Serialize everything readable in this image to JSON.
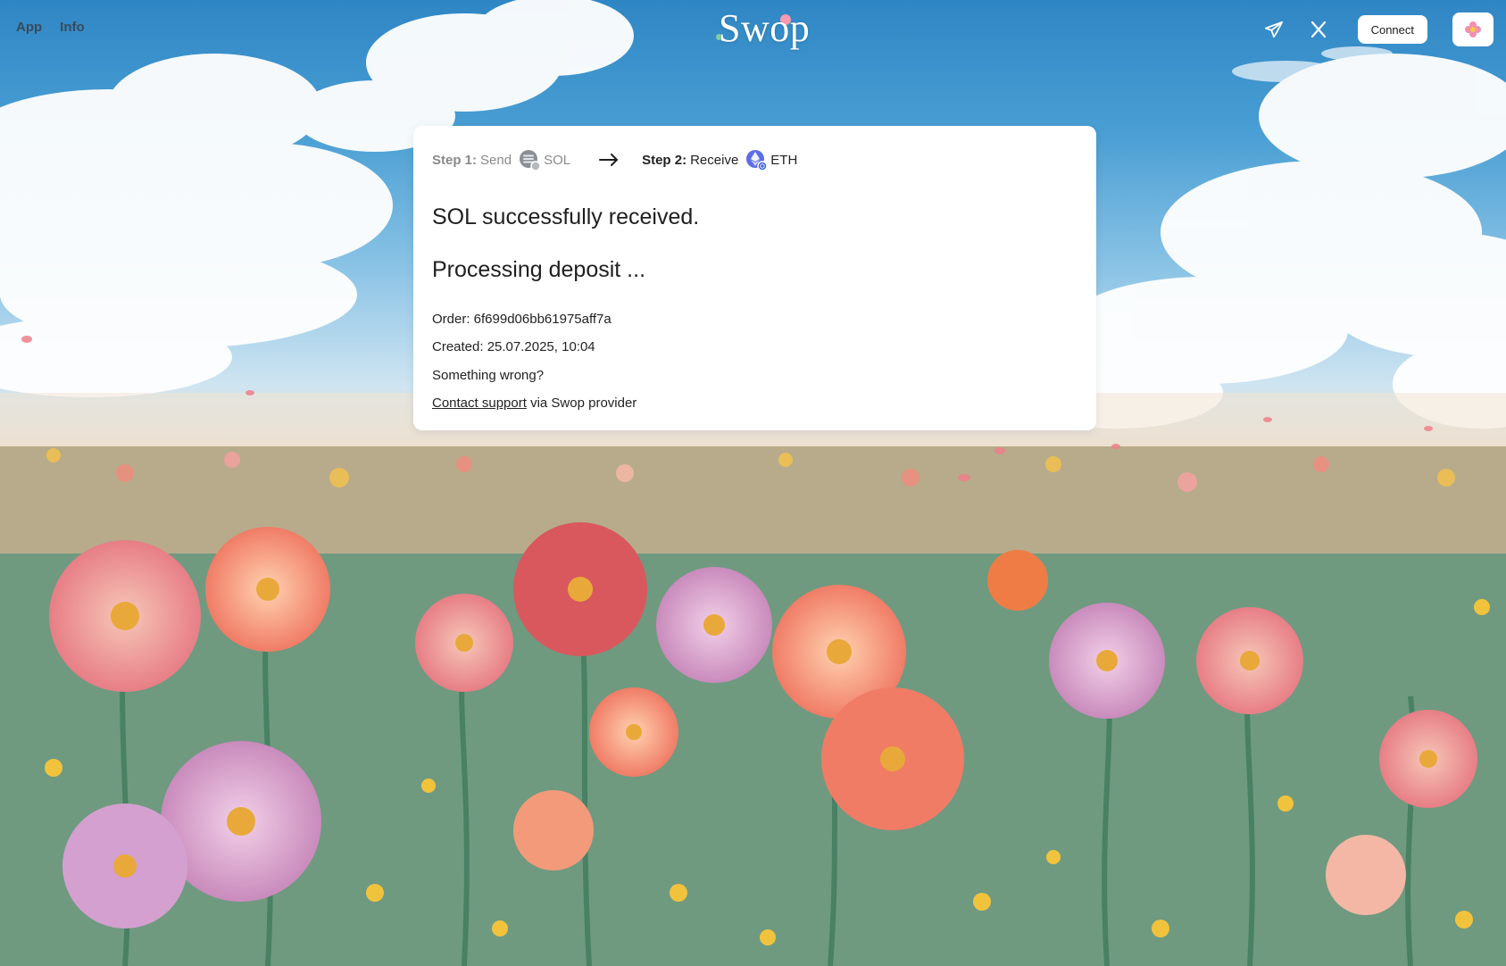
{
  "nav": {
    "app": "App",
    "info": "Info"
  },
  "brand": {
    "logo": "Swop"
  },
  "header_right": {
    "telegram_icon": "telegram-icon",
    "x_icon": "x-icon",
    "connect": "Connect",
    "profile_icon": "flower-icon"
  },
  "steps": {
    "step1_label": "Step 1:",
    "step1_action": "Send",
    "step1_token": "SOL",
    "step2_label": "Step 2:",
    "step2_action": "Receive",
    "step2_token": "ETH"
  },
  "status": {
    "received": "SOL successfully received.",
    "processing": "Processing deposit ..."
  },
  "order": {
    "order_line": "Order: 6f699d06bb61975aff7a",
    "created_line": "Created: 25.07.2025, 10:04"
  },
  "help": {
    "question": "Something wrong?",
    "contact_link": "Contact support",
    "via_text": " via Swop provider"
  },
  "colors": {
    "sky": "#2f86c4",
    "card": "#ffffff",
    "text": "#222222",
    "muted": "#8a8a8a"
  }
}
